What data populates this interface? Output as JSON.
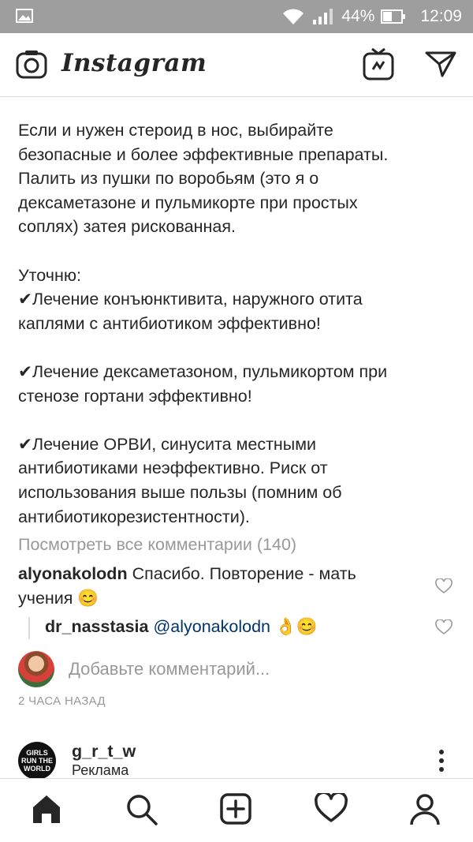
{
  "status_bar": {
    "battery_percent": "44%",
    "time": "12:09",
    "icons": [
      "gallery-icon",
      "wifi-icon",
      "signal-icon",
      "battery-icon"
    ]
  },
  "header": {
    "app_name": "Instagram",
    "icons": [
      "camera-icon",
      "igtv-icon",
      "direct-message-icon"
    ]
  },
  "post": {
    "caption_paragraphs": [
      [
        "Если и нужен стероид в нос, выбирайте",
        "безопасные и более эффективные препараты.",
        "Палить из пушки по воробьям (это я о",
        "дексаметазоне и пульмикорте при простых",
        "соплях) затея рискованная."
      ],
      [
        "Уточню:",
        "✔Лечение конъюнктивита, наружного отита",
        "каплями с антибиотиком эффективно!"
      ],
      [
        "✔Лечение дексаметазоном, пульмикортом при",
        "стенозе гортани эффективно!"
      ],
      [
        "✔Лечение ОРВИ, синусита местными",
        "антибиотиками неэффективно. Риск от",
        "использования выше пользы (помним об",
        "антибиотикорезистентности)."
      ]
    ],
    "view_all_comments": "Посмотреть все комментарии (140)",
    "comments": [
      {
        "username": "alyonakolodn",
        "text_line1": "Спасибо. Повторение - мать",
        "text_line2": "учения",
        "emoji": "😊"
      },
      {
        "username": "dr_nasstasia",
        "mention": "@alyonakolodn",
        "emoji": "👌😊"
      }
    ],
    "add_comment_placeholder": "Добавьте комментарий...",
    "time_ago": "2 ЧАСА НАЗАД"
  },
  "next_post": {
    "username": "g_r_t_w",
    "sponsored_label": "Реклама",
    "avatar_text": "GIRLS RUN THE WORLD"
  },
  "bottom_nav": {
    "items": [
      "home-icon",
      "search-icon",
      "new-post-icon",
      "activity-icon",
      "profile-icon"
    ]
  },
  "colors": {
    "status_bar": "#9e9e9e",
    "text": "#262626",
    "secondary_text": "#999999",
    "mention": "#003569",
    "divider": "#dbdbdb"
  }
}
